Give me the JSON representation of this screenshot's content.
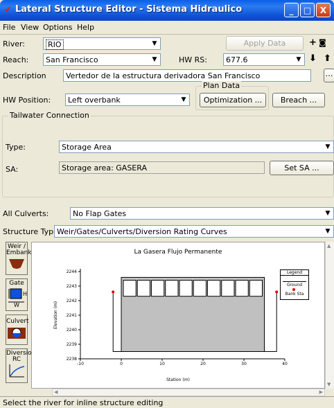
{
  "window": {
    "title": "Lateral Structure Editor - Sistema Hidraulico",
    "controls": [
      "_",
      "□",
      "X"
    ]
  },
  "menu": [
    "File",
    "View",
    "Options",
    "Help"
  ],
  "river": {
    "label": "River:",
    "value": "RIO"
  },
  "apply_data": "Apply Data",
  "reach": {
    "label": "Reach:",
    "value": "San Francisco"
  },
  "hw_rs": {
    "label": "HW RS:",
    "value": "677.6"
  },
  "description": {
    "label": "Description",
    "value": "Vertedor de la estructura derivadora San Francisco"
  },
  "hw_position": {
    "label": "HW Position:",
    "value": "Left overbank"
  },
  "plan_data": {
    "title": "Plan Data",
    "optimization": "Optimization ..."
  },
  "breach": "Breach ...",
  "tailwater": {
    "title": "Tailwater Connection",
    "type_label": "Type:",
    "type_value": "Storage Area",
    "sa_label": "SA:",
    "sa_value": "Storage area: GASERA",
    "set_sa": "Set SA ..."
  },
  "all_culverts": {
    "label": "All Culverts:",
    "value": "No Flap Gates"
  },
  "structure_type": {
    "label": "Structure Type:",
    "value": "Weir/Gates/Culverts/Diversion Rating Curves"
  },
  "side_buttons": [
    {
      "label": "Weir / Embankment",
      "icon": "weir-icon"
    },
    {
      "label": "Gate",
      "icon": "gate-icon",
      "extra": "H",
      "extra2": "W"
    },
    {
      "label": "Culvert",
      "icon": "culvert-icon"
    },
    {
      "label": "Diversion RC",
      "icon": "rating-curve-icon"
    }
  ],
  "legend": {
    "title": "Legend",
    "ground": "Ground",
    "bank_sta": "Bank Sta"
  },
  "chart_data": {
    "type": "line",
    "title": "La Gasera Flujo Permanente",
    "xlabel": "Station (m)",
    "ylabel": "Elevation (m)",
    "xlim": [
      -10,
      40
    ],
    "ylim": [
      2238,
      2244
    ],
    "x_ticks": [
      "-10",
      "0",
      "10",
      "20",
      "30",
      "40"
    ],
    "y_ticks": [
      "2238",
      "2239",
      "2240",
      "2241",
      "2242",
      "2243",
      "2244"
    ],
    "ground": {
      "x": [
        -2,
        -2,
        38,
        38
      ],
      "y": [
        2242.6,
        2238.5,
        2238.5,
        2242.6
      ]
    },
    "weir_top": {
      "x": [
        0,
        35
      ],
      "y": [
        2243.6,
        2243.6
      ]
    },
    "gate_openings": {
      "count": 10,
      "bottom": 2242.3,
      "top": 2243.4
    },
    "bank_stations": [
      {
        "x": -2,
        "y": 2242.6
      },
      {
        "x": 38,
        "y": 2242.6
      }
    ],
    "colors": {
      "ground": "#000000",
      "fill": "#c0c0c0",
      "bank": "#e00000"
    }
  },
  "status": "Select the river for inline structure editing"
}
